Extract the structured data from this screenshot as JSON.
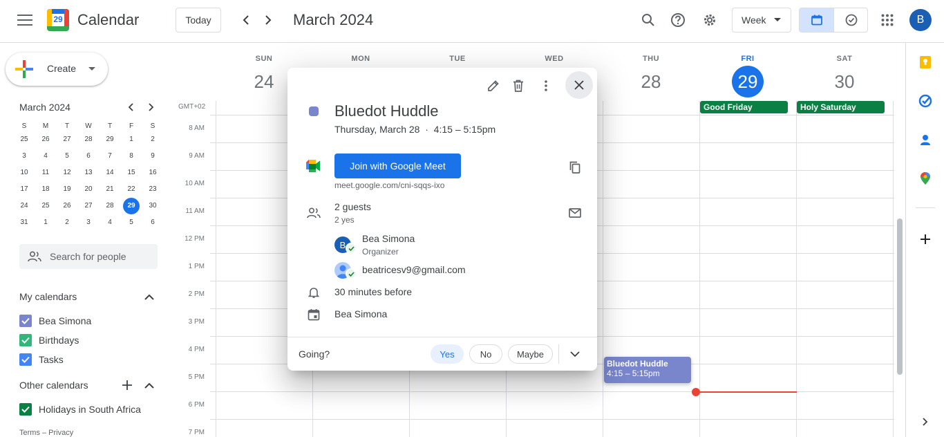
{
  "header": {
    "app_title": "Calendar",
    "logo_day": "29",
    "today_label": "Today",
    "month_title": "March 2024",
    "view_label": "Week",
    "avatar_letter": "B"
  },
  "sidebar": {
    "create_label": "Create",
    "mini_month_title": "March 2024",
    "dow": [
      "S",
      "M",
      "T",
      "W",
      "T",
      "F",
      "S"
    ],
    "weeks": [
      [
        "25",
        "26",
        "27",
        "28",
        "29",
        "1",
        "2"
      ],
      [
        "3",
        "4",
        "5",
        "6",
        "7",
        "8",
        "9"
      ],
      [
        "10",
        "11",
        "12",
        "13",
        "14",
        "15",
        "16"
      ],
      [
        "17",
        "18",
        "19",
        "20",
        "21",
        "22",
        "23"
      ],
      [
        "24",
        "25",
        "26",
        "27",
        "28",
        "29",
        "30"
      ],
      [
        "31",
        "1",
        "2",
        "3",
        "4",
        "5",
        "6"
      ]
    ],
    "search_people_placeholder": "Search for people",
    "my_calendars_title": "My calendars",
    "my_calendars": [
      {
        "label": "Bea Simona",
        "color": "#7986cb"
      },
      {
        "label": "Birthdays",
        "color": "#33b679"
      },
      {
        "label": "Tasks",
        "color": "#4285f4"
      }
    ],
    "other_calendars_title": "Other calendars",
    "other_calendars": [
      {
        "label": "Holidays in South Africa",
        "color": "#0b8043"
      }
    ],
    "footer": "Terms – Privacy"
  },
  "grid": {
    "timezone": "GMT+02",
    "days": [
      {
        "dow": "SUN",
        "num": "24"
      },
      {
        "dow": "MON",
        "num": ""
      },
      {
        "dow": "TUE",
        "num": ""
      },
      {
        "dow": "WED",
        "num": ""
      },
      {
        "dow": "THU",
        "num": "28"
      },
      {
        "dow": "FRI",
        "num": "29"
      },
      {
        "dow": "SAT",
        "num": "30"
      }
    ],
    "hours": [
      "8 AM",
      "9 AM",
      "10 AM",
      "11 AM",
      "12 PM",
      "1 PM",
      "2 PM",
      "3 PM",
      "4 PM",
      "5 PM",
      "6 PM",
      "7 PM"
    ],
    "allday_events": [
      {
        "label": "Good Friday"
      },
      {
        "label": "Holy Saturday"
      }
    ],
    "event": {
      "title": "Bluedot Huddle",
      "time": "4:15 – 5:15pm"
    }
  },
  "popup": {
    "title": "Bluedot Huddle",
    "date_time": "Thursday, March 28  ·  4:15 – 5:15pm",
    "meet_button": "Join with Google Meet",
    "meet_link": "meet.google.com/cni-sqqs-ixo",
    "guests_count": "2 guests",
    "guests_summary": "2 yes",
    "guests": [
      {
        "name": "Bea Simona",
        "role": "Organizer",
        "initial": "B"
      },
      {
        "name": "beatricesv9@gmail.com",
        "role": "",
        "initial": ""
      }
    ],
    "reminder": "30 minutes before",
    "calendar_owner": "Bea Simona",
    "going_label": "Going?",
    "rsvp": {
      "yes": "Yes",
      "no": "No",
      "maybe": "Maybe"
    }
  },
  "colors": {
    "accent_blue": "#1a73e8",
    "event_lavender": "#7986cb",
    "holiday_green": "#0b8043",
    "now_red": "#ea4335"
  }
}
